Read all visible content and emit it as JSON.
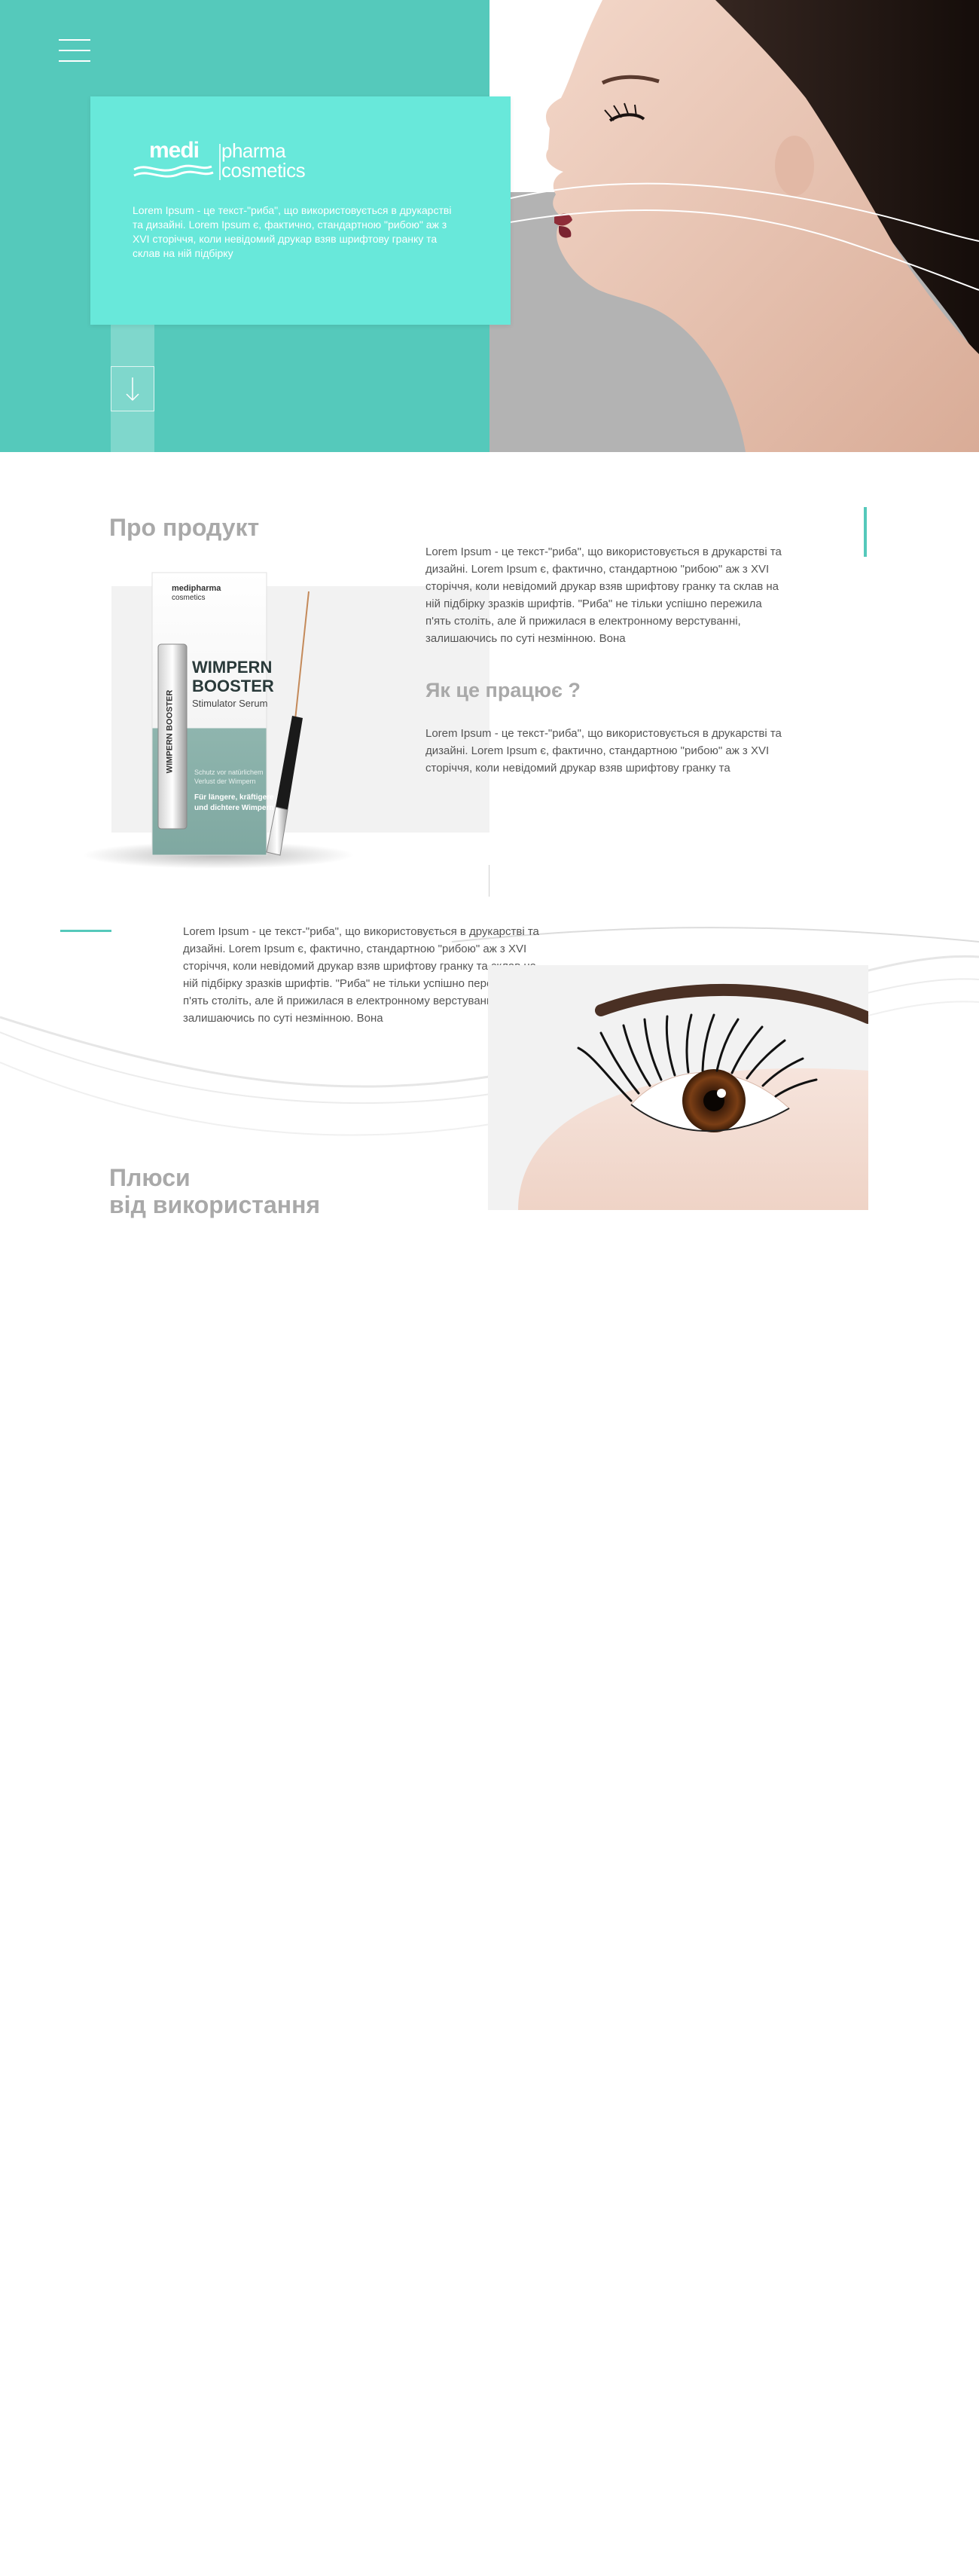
{
  "hero": {
    "logo": {
      "medi": "medi",
      "pharma": "pharma",
      "cosmetics": "cosmetics"
    },
    "text": "Lorem Ipsum - це текст-\"риба\", що використовується в друкарстві та дизайні. Lorem Ipsum є, фактично, стандартною \"рибою\" аж з XVI сторіччя, коли невідомий друкар взяв шрифтову гранку та склав на ній підбірку"
  },
  "about": {
    "title": "Про продукт",
    "text": "Lorem Ipsum - це текст-\"риба\", що використовується в друкарстві та дизайні. Lorem Ipsum є, фактично, стандартною \"рибою\" аж з XVI сторіччя, коли невідомий друкар взяв шрифтову гранку та склав на ній підбірку зразків шрифтів. \"Риба\" не тільки успішно пережила п'ять століть, але й прижилася в електронному верстуванні, залишаючись по суті незмінною. Вона",
    "how_title": "Як це працює ?",
    "how_text": "Lorem Ipsum - це текст-\"риба\", що використовується в друкарстві та дизайні. Lorem Ipsum є, фактично, стандартною \"рибою\" аж з XVI сторіччя, коли невідомий друкар взяв шрифтову гранку та",
    "product": {
      "box_brand_a": "medipharma",
      "box_brand_b": "cosmetics",
      "name_line1": "WIMPERN",
      "name_line2": "BOOSTER",
      "subtitle": "Stimulator Serum",
      "small_text_1": "Schutz vor natürlichem",
      "small_text_2": "Verlust der Wimpern",
      "small_text_3": "Für längere, kräftigere",
      "small_text_4": "und dichtere Wimpern",
      "vertical_label": "WIMPERN BOOSTER"
    }
  },
  "lashes": {
    "text": "Lorem Ipsum - це текст-\"риба\", що використовується в друкарстві та дизайні. Lorem Ipsum є, фактично, стандартною \"рибою\" аж з XVI сторіччя, коли невідомий друкар взяв шрифтову гранку та склав на ній підбірку зразків шрифтів. \"Риба\" не тільки успішно пережила п'ять століть, але й прижилася в електронному верстуванні, залишаючись по суті незмінною. Вона"
  },
  "benefits": {
    "title_line1": "Плюси",
    "title_line2": "від використання"
  },
  "colors": {
    "accent": "#55c9bb",
    "card": "#68e8da",
    "heading_gray": "#a9a9a9"
  },
  "icons": {
    "menu": "hamburger-menu-icon",
    "scroll": "arrow-down-icon"
  }
}
